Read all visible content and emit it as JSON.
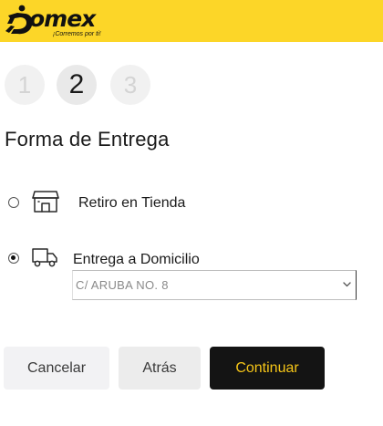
{
  "brand": {
    "name": "omex",
    "tagline": "¡Corremos por ti!",
    "header_color": "#fcd628"
  },
  "steps": [
    {
      "label": "1",
      "state": "inactive"
    },
    {
      "label": "2",
      "state": "active"
    },
    {
      "label": "3",
      "state": "inactive"
    }
  ],
  "section": {
    "title": "Forma de Entrega"
  },
  "delivery_options": [
    {
      "label": "Retiro en Tienda",
      "icon": "store-icon",
      "selected": false
    },
    {
      "label": "Entrega a Domicilio",
      "icon": "truck-icon",
      "selected": true
    }
  ],
  "address_select": {
    "value": "C/ ARUBA NO. 8"
  },
  "buttons": {
    "cancel": "Cancelar",
    "back": "Atrás",
    "continue": "Continuar"
  },
  "colors": {
    "continue_bg": "#141414",
    "continue_text": "#f5c518"
  }
}
